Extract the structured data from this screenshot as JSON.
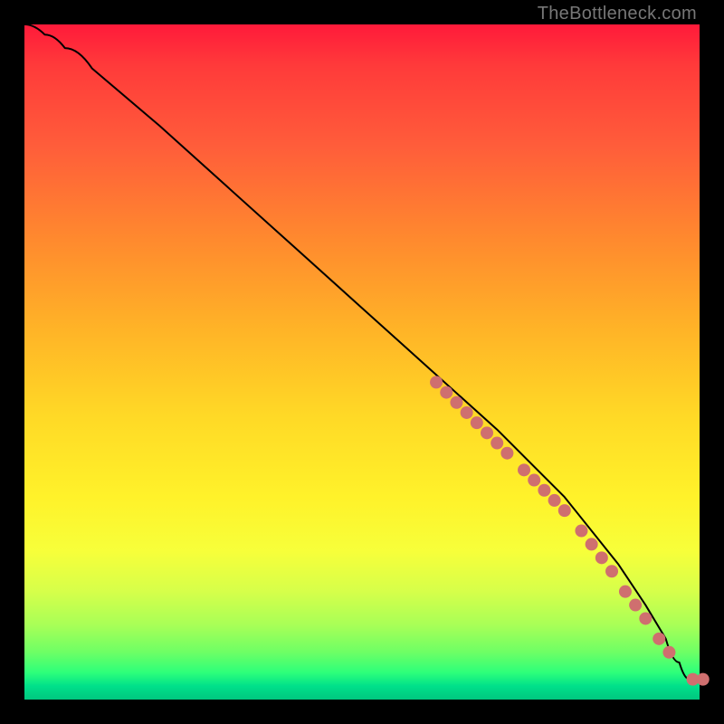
{
  "watermark": "TheBottleneck.com",
  "chart_data": {
    "type": "line",
    "title": "",
    "xlabel": "",
    "ylabel": "",
    "xlim": [
      0,
      100
    ],
    "ylim": [
      0,
      100
    ],
    "curve": {
      "description": "Smooth monotone-decreasing curve from top-left to bottom-right with a small flat tail at the end",
      "x": [
        0,
        3,
        6,
        10,
        20,
        30,
        40,
        50,
        60,
        70,
        80,
        88,
        92,
        95,
        97,
        98.5,
        100
      ],
      "y": [
        100,
        98.5,
        96.5,
        93.5,
        85,
        76,
        67,
        58,
        49,
        40,
        30,
        20,
        14,
        9,
        5.5,
        3,
        3
      ]
    },
    "scatter": {
      "color": "#cf6f6f",
      "radius_px": 7,
      "points": [
        {
          "x": 61,
          "y": 47
        },
        {
          "x": 62.5,
          "y": 45.5
        },
        {
          "x": 64,
          "y": 44
        },
        {
          "x": 65.5,
          "y": 42.5
        },
        {
          "x": 67,
          "y": 41
        },
        {
          "x": 68.5,
          "y": 39.5
        },
        {
          "x": 70,
          "y": 38
        },
        {
          "x": 71.5,
          "y": 36.5
        },
        {
          "x": 74,
          "y": 34
        },
        {
          "x": 75.5,
          "y": 32.5
        },
        {
          "x": 77,
          "y": 31
        },
        {
          "x": 78.5,
          "y": 29.5
        },
        {
          "x": 80,
          "y": 28
        },
        {
          "x": 82.5,
          "y": 25
        },
        {
          "x": 84,
          "y": 23
        },
        {
          "x": 85.5,
          "y": 21
        },
        {
          "x": 87,
          "y": 19
        },
        {
          "x": 89,
          "y": 16
        },
        {
          "x": 90.5,
          "y": 14
        },
        {
          "x": 92,
          "y": 12
        },
        {
          "x": 94,
          "y": 9
        },
        {
          "x": 95.5,
          "y": 7
        },
        {
          "x": 99,
          "y": 3
        },
        {
          "x": 100.5,
          "y": 3
        }
      ]
    }
  }
}
